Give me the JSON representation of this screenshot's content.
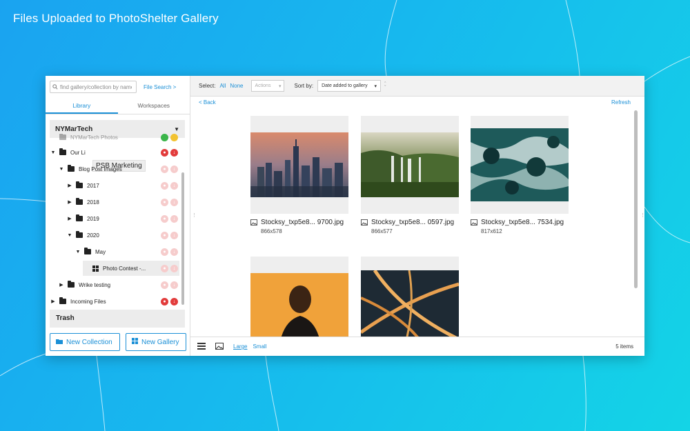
{
  "banner": {
    "title": "Files Uploaded to PhotoShelter Gallery"
  },
  "colors": {
    "accent": "#1a8fd6",
    "danger": "#e23c3c",
    "background_start": "#1aa3f0",
    "background_end": "#14d4e6"
  },
  "sidebar": {
    "search_placeholder": "find gallery/collection by name",
    "file_search_link": "File Search >",
    "tabs": [
      {
        "label": "Library",
        "active": true
      },
      {
        "label": "Workspaces",
        "active": false
      }
    ],
    "org_name": "NYMarTech",
    "tooltip": "PSB Marketing",
    "tree": [
      {
        "label": "NYMarTech Photos",
        "expanded": null
      },
      {
        "label": "Our Li",
        "expanded": true
      },
      {
        "label": "Blog Post Images",
        "expanded": true
      },
      {
        "label": "2017",
        "expanded": false
      },
      {
        "label": "2018",
        "expanded": false
      },
      {
        "label": "2019",
        "expanded": false
      },
      {
        "label": "2020",
        "expanded": true
      },
      {
        "label": "May",
        "expanded": true
      },
      {
        "label": "Photo Contest -...",
        "expanded": null,
        "type": "gallery",
        "selected": true
      },
      {
        "label": "Wrike testing",
        "expanded": false
      },
      {
        "label": "Incoming Files",
        "expanded": false
      }
    ],
    "trash_label": "Trash",
    "new_collection_label": "New Collection",
    "new_gallery_label": "New Gallery"
  },
  "toolbar": {
    "select_label": "Select:",
    "select_all": "All",
    "select_none": "None",
    "actions_label": "Actions",
    "sort_label": "Sort by:",
    "sort_value": "Date added to gallery"
  },
  "main": {
    "back_link": "< Back",
    "refresh_link": "Refresh",
    "files": [
      {
        "name": "Stocksy_txp5e8... 9700.jpg",
        "dims": "866x578",
        "image": "city skyline at dusk"
      },
      {
        "name": "Stocksy_txp5e8... 0597.jpg",
        "dims": "866x577",
        "image": "waterfalls in forest"
      },
      {
        "name": "Stocksy_txp5e8... 7534.jpg",
        "dims": "817x612",
        "image": "aerial ocean waves on rocks"
      },
      {
        "name": "",
        "dims": "",
        "image": "portrait on orange background"
      },
      {
        "name": "",
        "dims": "",
        "image": "highway interchange at night"
      }
    ]
  },
  "footer": {
    "size_large": "Large",
    "size_small": "Small",
    "item_count": "5 items"
  }
}
